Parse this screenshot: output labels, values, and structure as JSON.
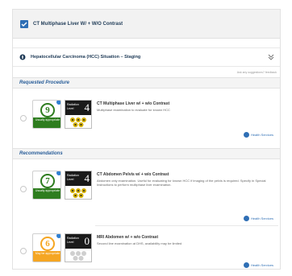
{
  "header": {
    "title": "CT Multiphase Liver W/ + W/O Contrast"
  },
  "indication": {
    "title": "Hepatocellular Carcinoma (HCC) Situation – Staging"
  },
  "feedback_text": "Ask any suggestions? feedback",
  "requested": {
    "heading": "Requested Procedure",
    "item": {
      "score": "9",
      "score_label": "Usually appropriate",
      "score_color": "#2e7d1f",
      "radiation_label": "Radiation Level",
      "radiation_level": "4",
      "title": "CT Multiphase Liver w/ + w/o Contrast",
      "body": "Multiphase examination to evaluate for known HCC",
      "provider": "Health Services"
    }
  },
  "recommendations": {
    "heading": "Recommendations",
    "items": [
      {
        "score": "7",
        "score_label": "Usually appropriate",
        "score_color": "#2e7d1f",
        "radiation_label": "Radiation Level",
        "radiation_level": "4",
        "title": "CT Abdomen Pelvis w/ + w/o Contrast",
        "body": "Abdomen only examination. Useful for evaluating for known HCC if imaging of the pelvis is required. Specify in Special Instructions to perform multiphase liver examination.",
        "provider": "Health Services"
      },
      {
        "score": "6",
        "score_label": "May be appropriate",
        "score_color": "#f5a623",
        "radiation_label": "Radiation Level",
        "radiation_level": "0",
        "title": "MRI Abdomen w/ + w/o Contrast",
        "body": "Second line examination at DHS, availability may be limited",
        "provider": "Health Services"
      }
    ]
  }
}
